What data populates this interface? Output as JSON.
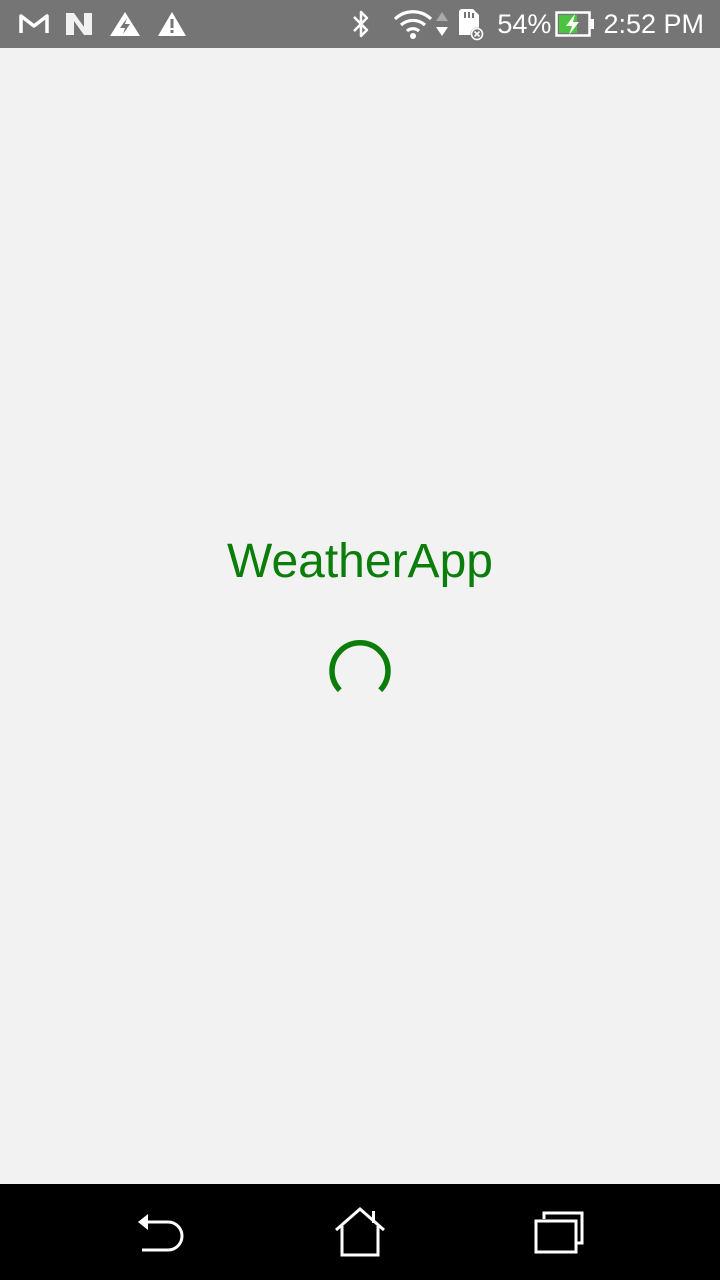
{
  "theme": {
    "accent": "#0a7d0a",
    "status_bar_bg": "#757575",
    "background": "#f2f2f2",
    "nav_bar_bg": "#000000"
  },
  "status_bar": {
    "left_icons": [
      "gmail-icon",
      "n-notification-icon",
      "sync-warning-icon",
      "warning-icon"
    ],
    "right_icons": [
      "bluetooth-icon",
      "wifi-icon",
      "data-arrows-icon",
      "sd-card-error-icon",
      "battery-charging-icon"
    ],
    "battery_percent": "54%",
    "time": "2:52 PM"
  },
  "main": {
    "app_title": "WeatherApp",
    "loading_indicator": "loading-spinner"
  },
  "nav_bar": {
    "buttons": [
      "back-icon",
      "home-icon",
      "recents-icon"
    ]
  }
}
